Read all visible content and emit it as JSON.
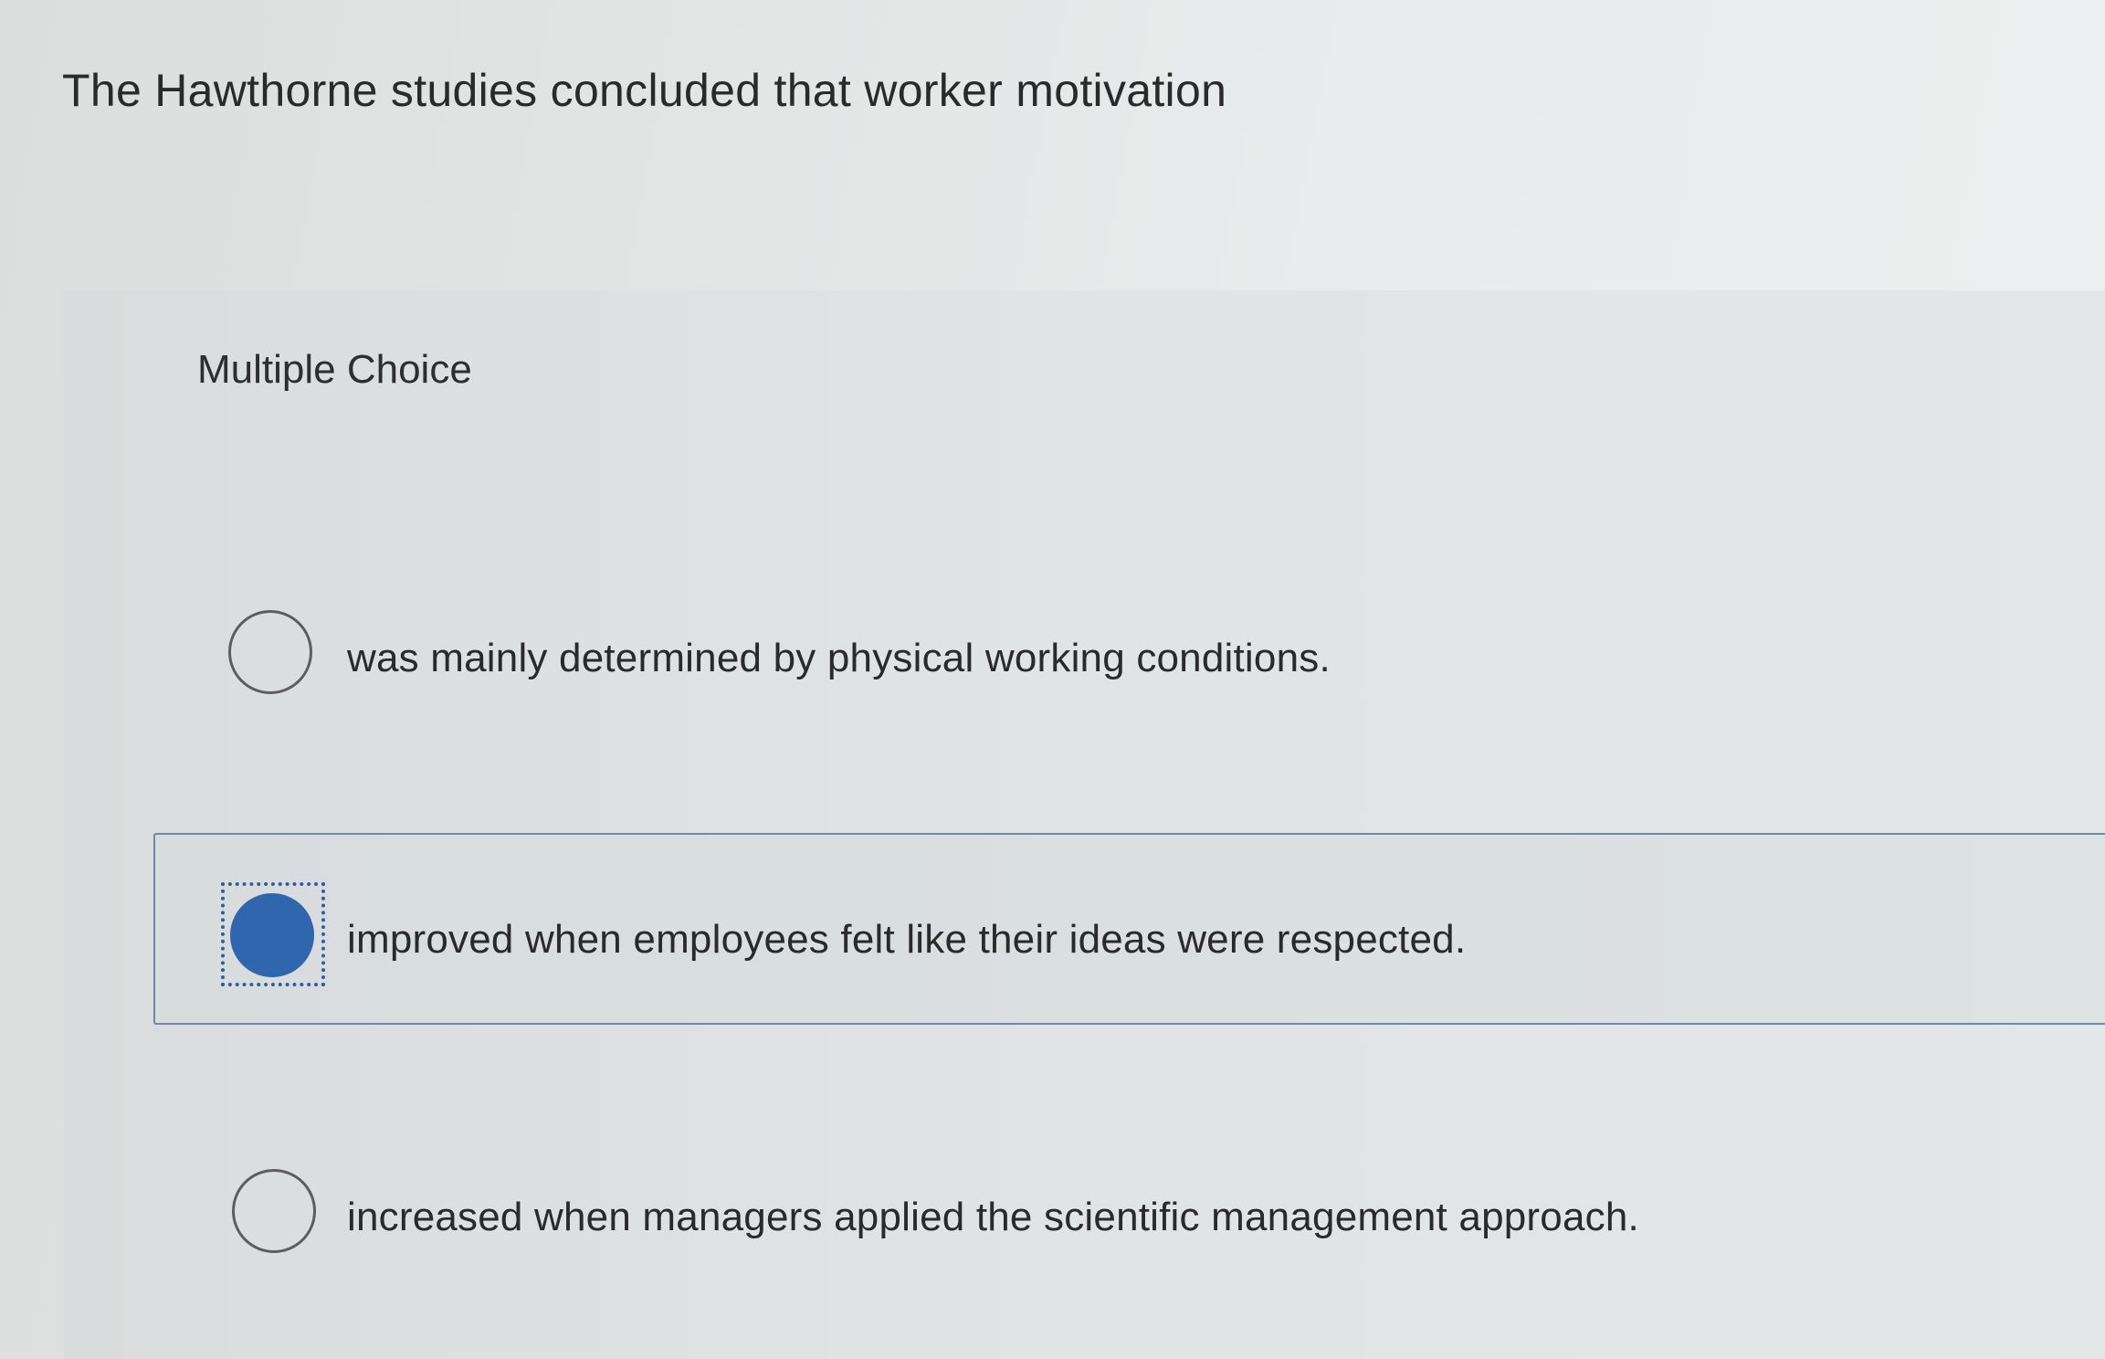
{
  "question": {
    "text": "The Hawthorne studies concluded that worker motivation"
  },
  "panel": {
    "header": "Multiple Choice"
  },
  "options": [
    {
      "text": "was mainly determined by physical working conditions.",
      "selected": false
    },
    {
      "text": "improved when employees felt like their ideas were respected.",
      "selected": true
    },
    {
      "text": "increased when managers applied the scientific management approach.",
      "selected": false
    }
  ],
  "colors": {
    "accent": "#2f66ad",
    "selected_border": "#6f8aa8"
  }
}
